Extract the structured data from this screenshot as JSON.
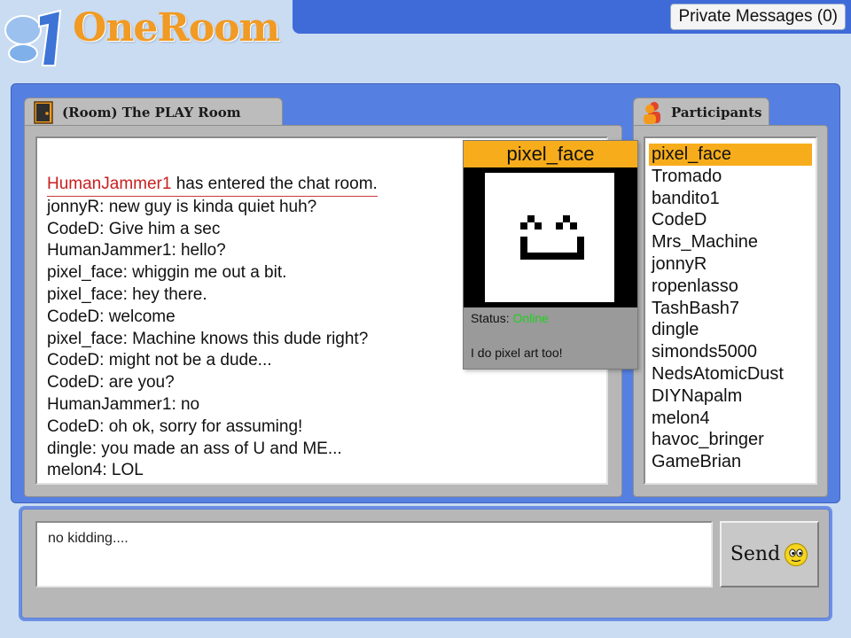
{
  "app": {
    "logo_text": "OneRoom",
    "private_messages_label": "Private Messages (0)"
  },
  "room": {
    "tab_label": "(Room) The PLAY Room"
  },
  "chat": {
    "system_message": {
      "nick": "HumanJammer1",
      "text": " has entered the chat room."
    },
    "messages": [
      {
        "nick": "jonnyR",
        "text": ": new guy is kinda quiet huh?"
      },
      {
        "nick": "CodeD",
        "text": ": Give him a sec"
      },
      {
        "nick": "HumanJammer1",
        "text": ": hello?"
      },
      {
        "nick": "pixel_face",
        "text": ": whiggin me out a bit."
      },
      {
        "nick": "pixel_face",
        "text": ": hey there."
      },
      {
        "nick": "CodeD",
        "text": ": welcome"
      },
      {
        "nick": "pixel_face",
        "text": ": Machine knows this dude right?"
      },
      {
        "nick": "CodeD",
        "text": ": might not be a dude..."
      },
      {
        "nick": "CodeD",
        "text": ": are you?"
      },
      {
        "nick": "HumanJammer1",
        "text": ": no"
      },
      {
        "nick": "CodeD",
        "text": ": oh ok, sorry for assuming!"
      },
      {
        "nick": "dingle",
        "text": ": you made an ass of U and ME..."
      },
      {
        "nick": "melon4",
        "text": ": LOL"
      }
    ]
  },
  "profile": {
    "name": "pixel_face",
    "status_label": "Status: ",
    "status_value": "Online",
    "bio": "I do pixel art too!"
  },
  "participants": {
    "tab_label": "Participants",
    "items": [
      "pixel_face",
      "Tromado",
      "bandito1",
      "CodeD",
      "Mrs_Machine",
      "jonnyR",
      "ropenlasso",
      "TashBash7",
      "dingle",
      "simonds5000",
      "NedsAtomicDust",
      "DIYNapalm",
      "melon4",
      "havoc_bringer",
      "GameBrian"
    ],
    "selected": "pixel_face"
  },
  "composer": {
    "value": "no kidding....",
    "send_label": "Send"
  },
  "colors": {
    "accent_orange": "#f7ad1b",
    "frame_blue": "#5580e2",
    "system_red": "#c92020",
    "status_green": "#1ed11e"
  }
}
